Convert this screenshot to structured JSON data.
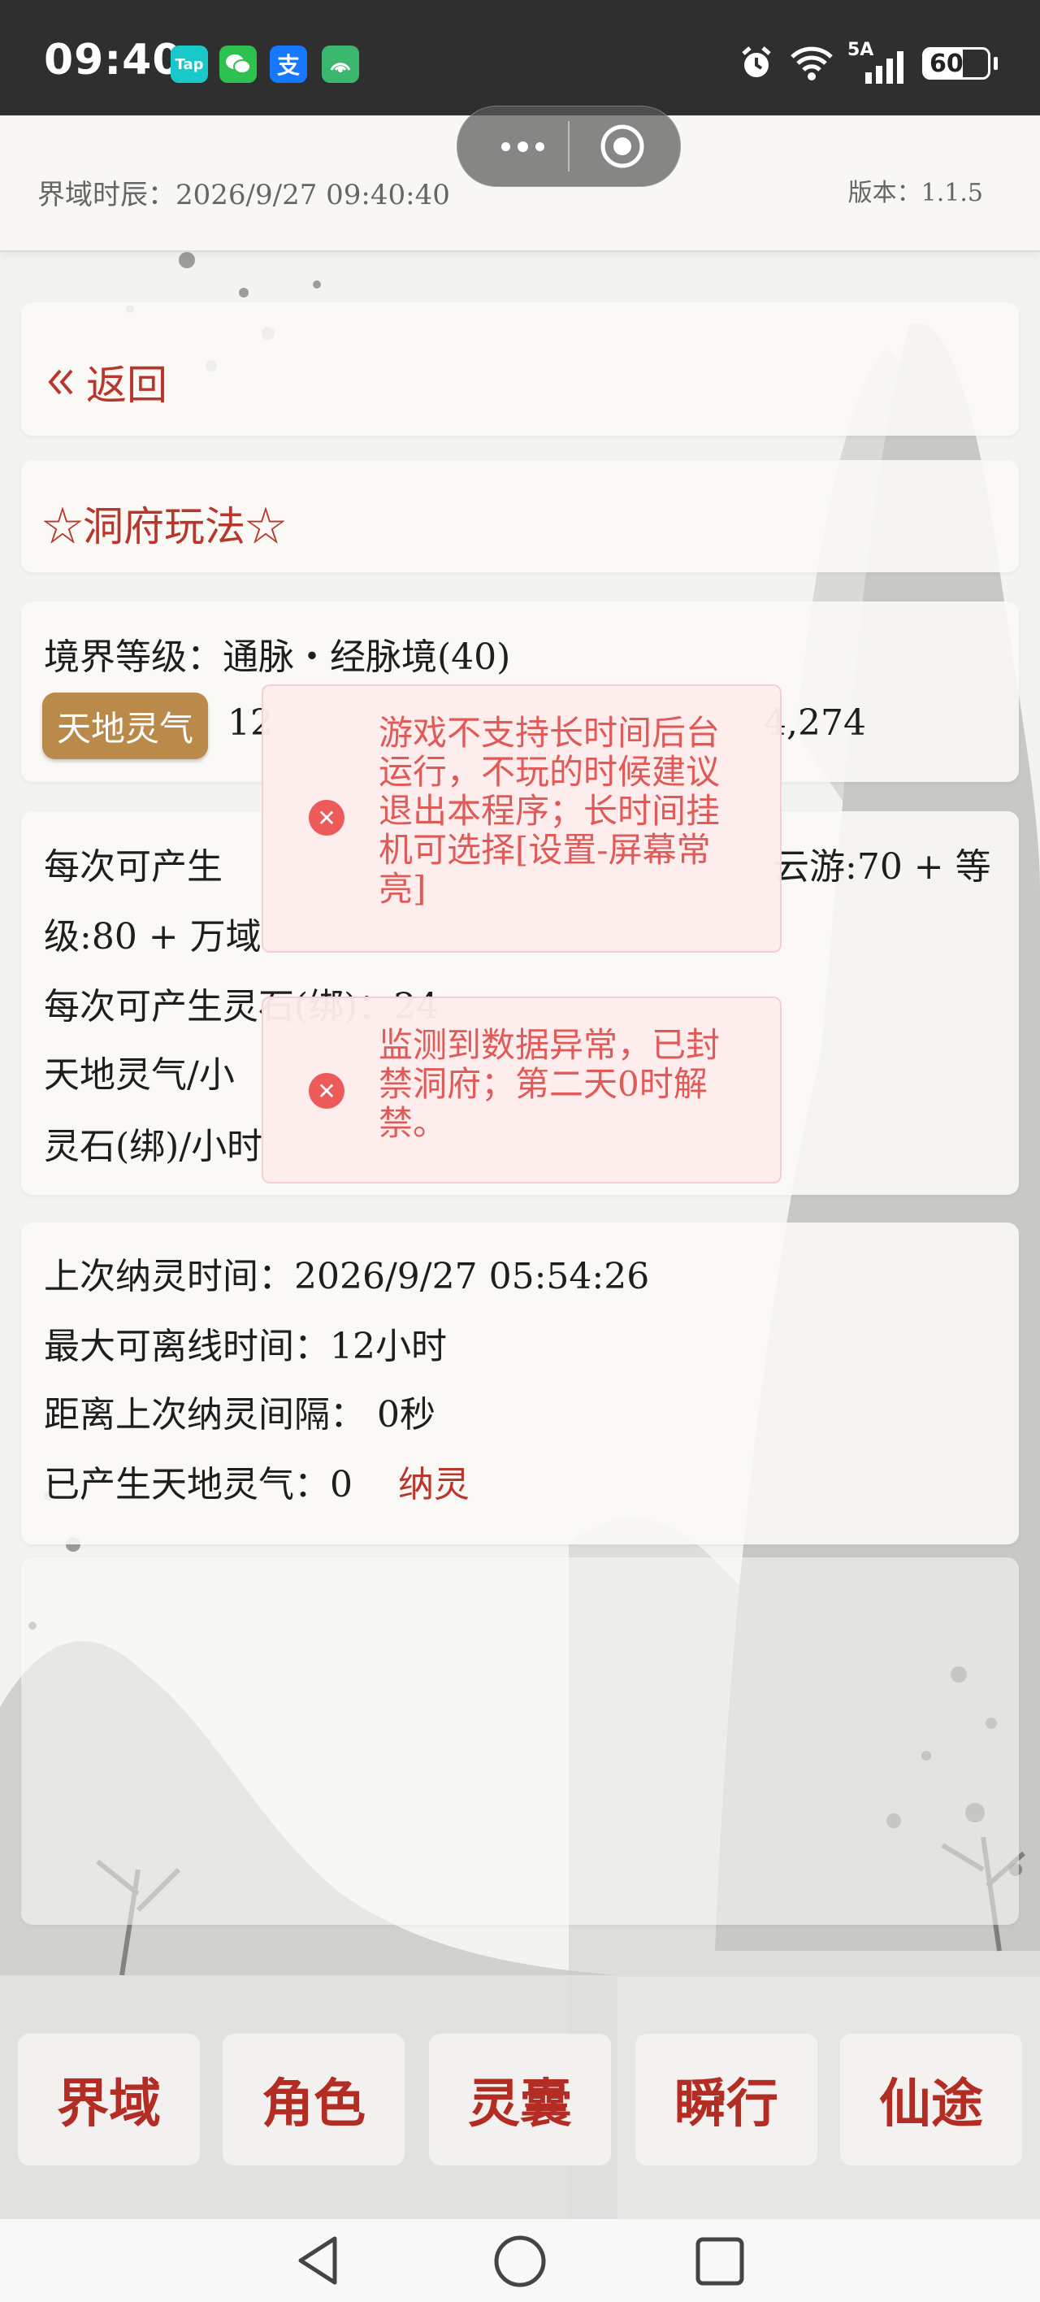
{
  "status_bar": {
    "time": "09:40",
    "apps": [
      {
        "icon": "taptap-icon",
        "label": "Tap",
        "color": "#19c8c8"
      },
      {
        "icon": "wechat-icon",
        "label": "",
        "color": "#2dc24f"
      },
      {
        "icon": "alipay-icon",
        "label": "支",
        "color": "#1677ff"
      },
      {
        "icon": "app-icon",
        "label": "",
        "color": "#3bb86e"
      }
    ],
    "network": "5A",
    "battery": "60",
    "battery_level": 0.6
  },
  "header": {
    "time_label": "界域时辰：2026/9/27 09:40:40",
    "version_label": "版本：1.1.5"
  },
  "back": {
    "label": "返回",
    "icon": "double-chevron-left-icon"
  },
  "section_title": "☆洞府玩法☆",
  "realm": {
    "level_line": "境界等级：通脉・经脉境(40)",
    "badge": "天地灵气",
    "value_left": "12",
    "value_right": "4,274"
  },
  "production": {
    "line1_left": "每次可产生",
    "line1_right": "云游:70 + 等",
    "line2": "级:80 + 万域",
    "line3": "每次可产生灵石(绑)：24",
    "line4": "天地灵气/小",
    "line5": "灵石(绑)/小时"
  },
  "absorb": {
    "last_time": "上次纳灵时间：2026/9/27 05:54:26",
    "max_offline": "最大可离线时间：12小时",
    "interval": "距离上次纳灵间隔： 0秒",
    "produced": "已产生天地灵气：0",
    "action": "纳灵"
  },
  "toasts": [
    {
      "icon": "error-icon",
      "text": "游戏不支持长时间后台运行，不玩的时候建议退出本程序；长时间挂机可选择[设置-屏幕常亮]"
    },
    {
      "icon": "error-icon",
      "text": "监测到数据异常，已封禁洞府；第二天0时解禁。"
    }
  ],
  "bottom_nav": [
    "界域",
    "角色",
    "灵囊",
    "瞬行",
    "仙途"
  ],
  "system_nav": [
    "back-triangle-icon",
    "home-circle-icon",
    "recent-square-icon"
  ],
  "colors": {
    "accent_red": "#b8372c",
    "badge_gold": "#b98a4a",
    "toast_text": "#e05a58"
  }
}
